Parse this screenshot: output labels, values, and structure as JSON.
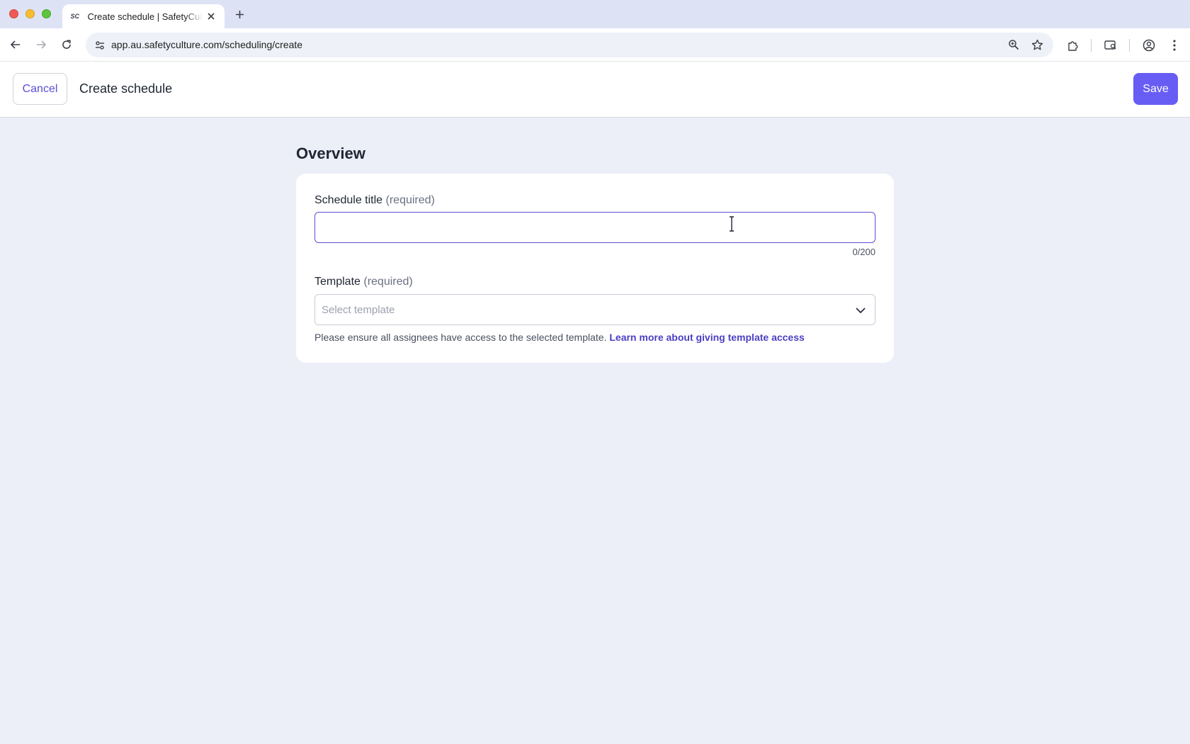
{
  "browser": {
    "tab_title": "Create schedule | SafetyCulture",
    "tab_favicon": "SC",
    "url": "app.au.safetyculture.com/scheduling/create"
  },
  "header": {
    "cancel_label": "Cancel",
    "title": "Create schedule",
    "save_label": "Save"
  },
  "overview": {
    "section_title": "Overview",
    "schedule_title": {
      "label": "Schedule title",
      "required_hint": "(required)",
      "value": "",
      "counter": "0/200"
    },
    "template": {
      "label": "Template",
      "required_hint": "(required)",
      "placeholder": "Select template",
      "help_text": "Please ensure all assignees have access to the selected template.",
      "help_link": "Learn more about giving template access"
    }
  },
  "colors": {
    "accent": "#675df4",
    "link": "#4b3fc2",
    "background": "#eceef8"
  }
}
